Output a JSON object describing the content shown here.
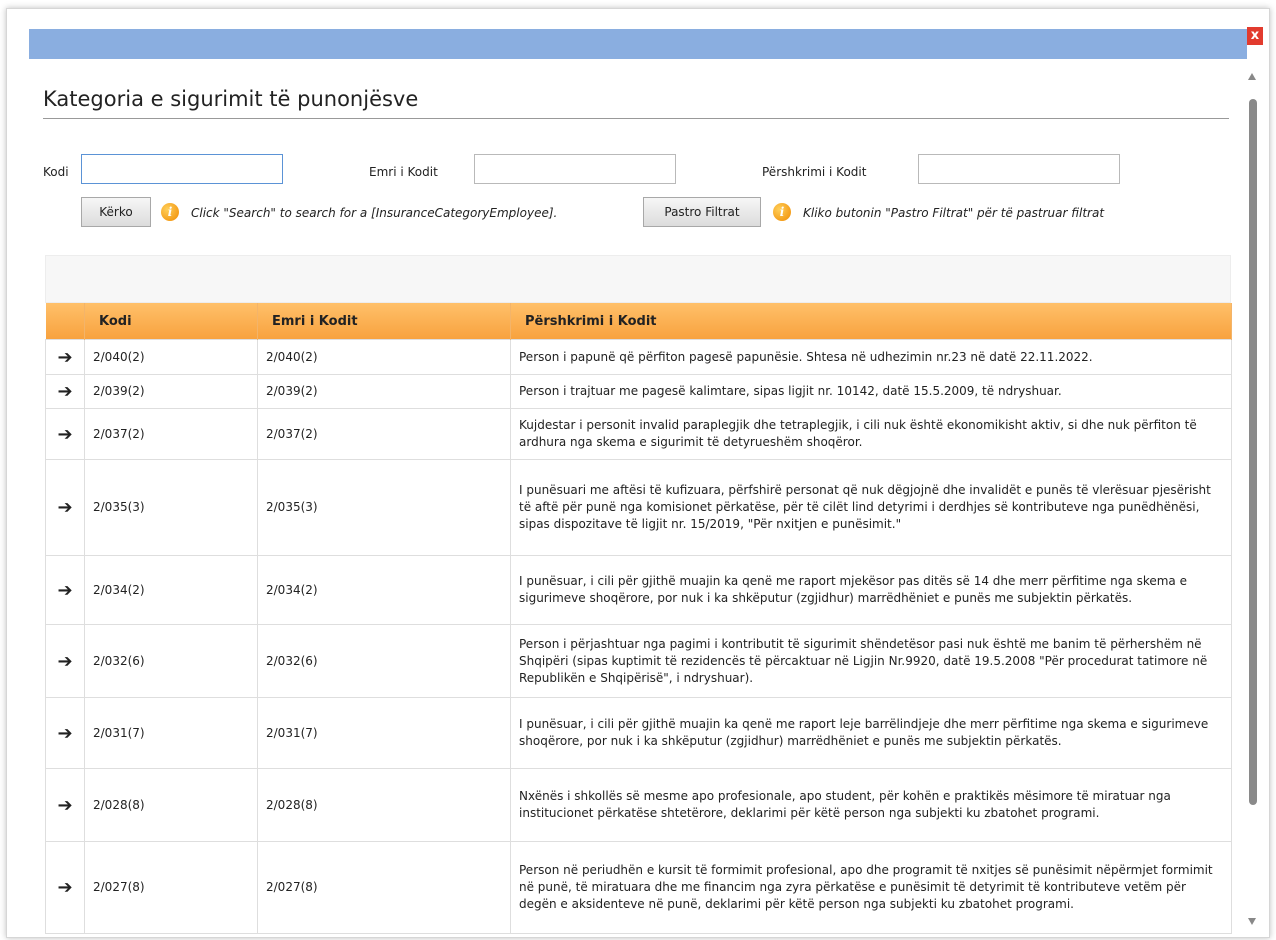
{
  "window": {
    "close_symbol": "x"
  },
  "page_title": "Kategoria e sigurimit të punonjësve",
  "filters": {
    "kodi_label": "Kodi",
    "kodi_value": "",
    "emri_label": "Emri i Kodit",
    "emri_value": "",
    "pershkrimi_label": "Përshkrimi i Kodit",
    "pershkrimi_value": ""
  },
  "actions": {
    "search_label": "Kërko",
    "search_hint": "Click \"Search\" to search for a [InsuranceCategoryEmployee].",
    "clear_label": "Pastro Filtrat",
    "clear_hint": "Kliko butonin \"Pastro Filtrat\" për të pastruar filtrat"
  },
  "table": {
    "columns": [
      "Kodi",
      "Emri i Kodit",
      "Përshkrimi i Kodit"
    ],
    "row_icon": "arrow-right-icon",
    "rows": [
      {
        "kodi": "2/040(2)",
        "emri": "2/040(2)",
        "pershkrimi": "Person i papunë që përfiton pagesë papunësie. Shtesa në udhezimin nr.23 në datë 22.11.2022."
      },
      {
        "kodi": "2/039(2)",
        "emri": "2/039(2)",
        "pershkrimi": "Person i trajtuar me pagesë kalimtare, sipas ligjit nr. 10142, datë 15.5.2009, të ndryshuar."
      },
      {
        "kodi": "2/037(2)",
        "emri": "2/037(2)",
        "pershkrimi": "Kujdestar i personit invalid paraplegjik dhe tetraplegjik, i cili nuk është ekonomikisht aktiv, si dhe nuk përfiton të ardhura nga skema e sigurimit të detyrueshëm shoqëror."
      },
      {
        "kodi": "2/035(3)",
        "emri": "2/035(3)",
        "pershkrimi": "I punësuari me aftësi të kufizuara, përfshirë personat që nuk dëgjojnë dhe invalidët e punës të vlerësuar pjesërisht të aftë për punë nga komisionet përkatëse, për të cilët lind detyrimi i derdhjes së kontributeve nga punëdhënësi, sipas dispozitave të ligjit nr. 15/2019, \"Për nxitjen e punësimit.\""
      },
      {
        "kodi": "2/034(2)",
        "emri": "2/034(2)",
        "pershkrimi": "I punësuar, i cili për gjithë muajin ka qenë me raport mjekësor pas ditës së 14 dhe merr përfitime nga skema e sigurimeve shoqërore, por nuk i ka shkëputur (zgjidhur) marrëdhëniet e punës me subjektin përkatës."
      },
      {
        "kodi": "2/032(6)",
        "emri": "2/032(6)",
        "pershkrimi": "Person i përjashtuar nga pagimi i kontributit të sigurimit shëndetësor pasi nuk është me banim të përhershëm në Shqipëri (sipas kuptimit të rezidencës të përcaktuar në Ligjin Nr.9920, datë 19.5.2008 \"Për procedurat tatimore në Republikën e Shqipërisë\", i ndryshuar)."
      },
      {
        "kodi": "2/031(7)",
        "emri": "2/031(7)",
        "pershkrimi": "I punësuar, i cili për gjithë muajin ka qenë me raport leje barrëlindjeje dhe merr përfitime nga skema e sigurimeve shoqërore, por nuk i ka shkëputur (zgjidhur) marrëdhëniet e punës me subjektin përkatës."
      },
      {
        "kodi": "2/028(8)",
        "emri": "2/028(8)",
        "pershkrimi": "Nxënës i shkollës së mesme apo profesionale, apo student, për kohën e praktikës mësimore të miratuar nga institucionet përkatëse shtetërore, deklarimi për këtë person nga subjekti ku zbatohet programi."
      },
      {
        "kodi": "2/027(8)",
        "emri": "2/027(8)",
        "pershkrimi": "Person në periudhën e kursit të formimit profesional, apo dhe programit të nxitjes së punësimit nëpërmjet formimit në punë, të miratuara dhe me financim nga zyra përkatëse e punësimit të detyrimit të kontributeve vetëm për degën e aksidenteve në punë, deklarimi për këtë person nga subjekti ku zbatohet programi."
      }
    ]
  },
  "colors": {
    "titlebar": "#8aaee0",
    "header_orange": "#f8a23e",
    "close_red": "#e23b2e",
    "info_orange": "#f08a00"
  }
}
